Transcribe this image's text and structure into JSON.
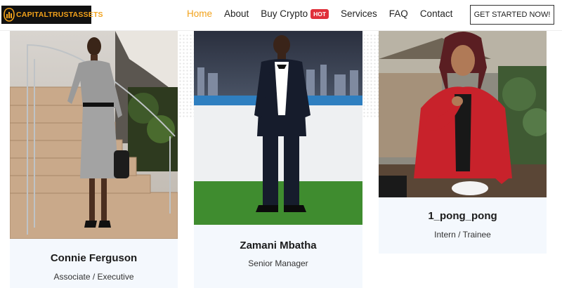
{
  "header": {
    "logo_text": "CAPITALTRUSTASSETS",
    "nav": [
      {
        "label": "Home",
        "active": true
      },
      {
        "label": "About",
        "active": false
      },
      {
        "label": "Buy Crypto",
        "active": false,
        "badge": "HOT"
      },
      {
        "label": "Services",
        "active": false
      },
      {
        "label": "FAQ",
        "active": false
      },
      {
        "label": "Contact",
        "active": false
      }
    ],
    "cta_label": "GET STARTED NOW!"
  },
  "team": [
    {
      "name": "Connie Ferguson",
      "role": "Associate / Executive"
    },
    {
      "name": "Zamani Mbatha",
      "role": "Senior Manager"
    },
    {
      "name": "1_pong_pong",
      "role": "Intern / Trainee"
    }
  ],
  "colors": {
    "accent": "#f2a21b",
    "badge": "#e0303a",
    "card_bg": "#f4f8fd"
  }
}
